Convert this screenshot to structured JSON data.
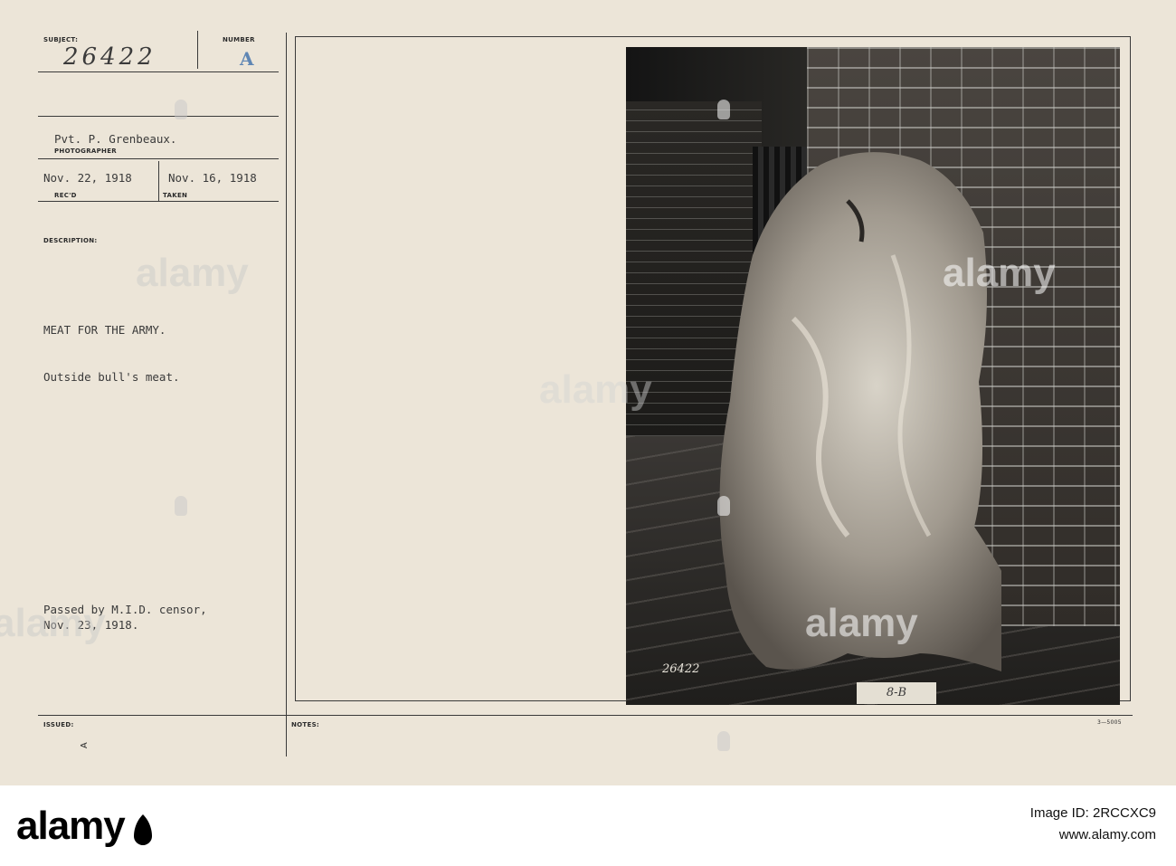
{
  "card": {
    "subject_label": "SUBJECT:",
    "subject_value": "26422",
    "number_label": "NUMBER",
    "number_value": "A",
    "photographer_value": "Pvt. P. Grenbeaux.",
    "photographer_label": "PHOTOGRAPHER",
    "recd_value": "Nov. 22, 1918",
    "recd_label": "REC'D",
    "taken_value": "Nov. 16, 1918",
    "taken_label": "TAKEN",
    "description_label": "DESCRIPTION:",
    "description_title": "MEAT FOR THE ARMY.",
    "description_body": "Outside bull's meat.",
    "censor_line1": "Passed by M.I.D. censor,",
    "censor_line2": "Nov. 23, 1918.",
    "issued_label": "ISSUED:",
    "issued_value": "A",
    "notes_label": "NOTES:",
    "form_number": "3—5005"
  },
  "photo": {
    "negative_number": "26422",
    "tag": "8-B"
  },
  "watermark": {
    "text": "alamy"
  },
  "footer": {
    "logo": "alamy",
    "image_id_label": "Image ID: 2RCCXC9",
    "website": "www.alamy.com"
  }
}
